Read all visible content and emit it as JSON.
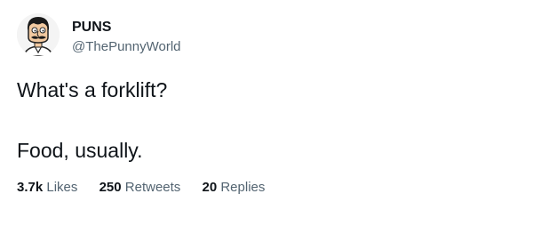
{
  "tweet": {
    "author": {
      "display_name": "PUNS",
      "handle": "@ThePunnyWorld"
    },
    "text_lines": [
      "What's a forklift?",
      "Food, usually."
    ],
    "stats": {
      "likes": {
        "count": "3.7k",
        "label": "Likes"
      },
      "retweets": {
        "count": "250",
        "label": "Retweets"
      },
      "replies": {
        "count": "20",
        "label": "Replies"
      }
    }
  },
  "icons": {
    "avatar": "cartoon-man-avatar"
  },
  "colors": {
    "primary_text": "#0f1419",
    "secondary_text": "#536471",
    "background": "#ffffff"
  }
}
